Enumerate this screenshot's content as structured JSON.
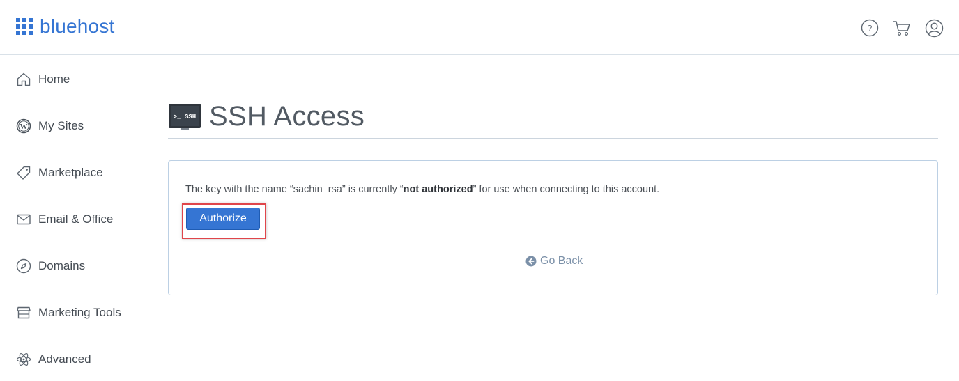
{
  "header": {
    "brand": "bluehost",
    "icons": [
      "help-icon",
      "cart-icon",
      "account-icon"
    ]
  },
  "sidebar": {
    "items": [
      {
        "label": "Home",
        "icon": "home-icon"
      },
      {
        "label": "My Sites",
        "icon": "wordpress-icon"
      },
      {
        "label": "Marketplace",
        "icon": "tag-icon"
      },
      {
        "label": "Email & Office",
        "icon": "envelope-icon"
      },
      {
        "label": "Domains",
        "icon": "compass-icon"
      },
      {
        "label": "Marketing Tools",
        "icon": "storefront-icon"
      },
      {
        "label": "Advanced",
        "icon": "atom-icon"
      }
    ]
  },
  "main": {
    "title": "SSH Access",
    "title_icon_text": ">_ SSH",
    "message_prefix": "The key with the name “sachin_rsa” is currently “",
    "message_bold": "not authorized",
    "message_suffix": "” for use when connecting to this account.",
    "authorize_label": "Authorize",
    "go_back_label": "Go Back"
  },
  "colors": {
    "brand": "#3575d3",
    "highlight": "#e0454a",
    "link": "#7b90a8"
  }
}
